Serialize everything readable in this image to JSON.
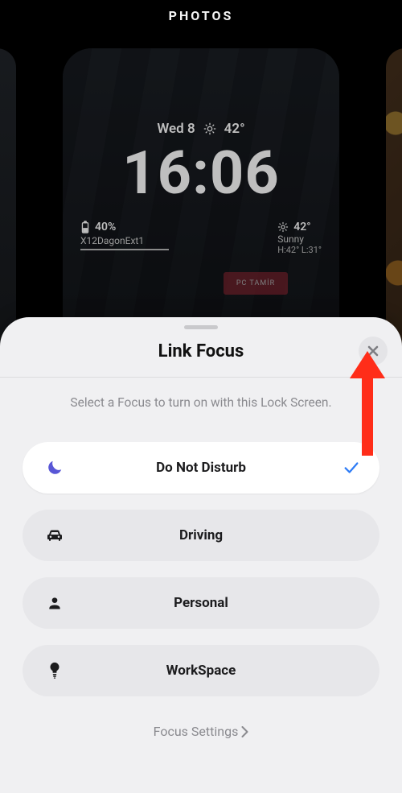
{
  "gallery": {
    "title": "PHOTOS"
  },
  "lockscreen": {
    "date_day": "Wed 8",
    "temperature": "42°",
    "time": "16:06",
    "widgets": {
      "battery_percent": "40%",
      "wifi_name": "X12DagonExt1",
      "weather_temp": "42°",
      "weather_cond": "Sunny",
      "weather_hilo": "H:42° L:31°"
    },
    "sign_text": "PC TAMİR"
  },
  "sheet": {
    "title": "Link Focus",
    "subtitle": "Select a Focus to turn on with this Lock Screen.",
    "focuses": [
      {
        "label": "Do Not Disturb",
        "icon": "moon",
        "selected": true
      },
      {
        "label": "Driving",
        "icon": "car",
        "selected": false
      },
      {
        "label": "Personal",
        "icon": "person",
        "selected": false
      },
      {
        "label": "WorkSpace",
        "icon": "bulb",
        "selected": false
      }
    ],
    "settings_label": "Focus Settings"
  },
  "colors": {
    "accent_check": "#2e7cf6",
    "moon": "#5856d6",
    "arrow": "#ff2d19"
  }
}
